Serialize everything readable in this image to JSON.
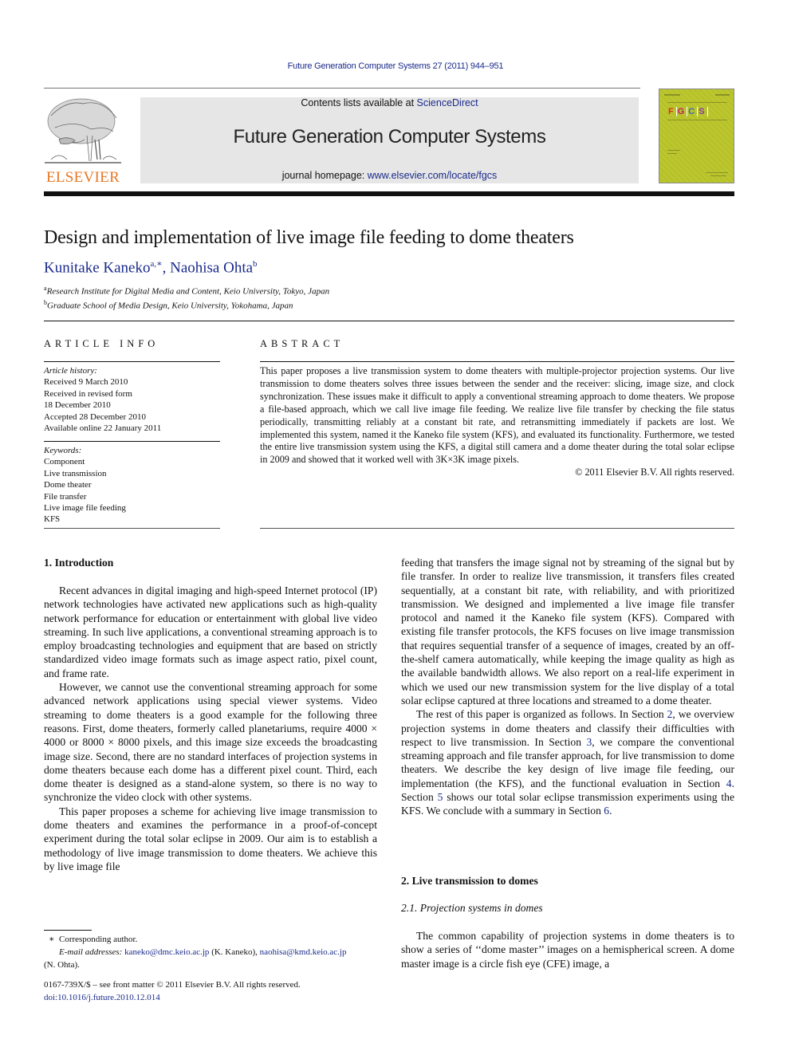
{
  "header": {
    "running_head": "Future Generation Computer Systems 27 (2011) 944–951",
    "contents_prefix": "Contents lists available at ",
    "contents_link": "ScienceDirect",
    "journal_title": "Future Generation Computer Systems",
    "homepage_prefix": "journal homepage: ",
    "homepage_link": "www.elsevier.com/locate/fgcs",
    "publisher_logo_text": "ELSEVIER",
    "cover_letters": [
      "F",
      "G",
      "C",
      "S"
    ]
  },
  "article": {
    "title": "Design and implementation of live image file feeding to dome theaters",
    "authors": [
      {
        "name": "Kunitake Kaneko",
        "marks": "a,∗"
      },
      {
        "name": "Naohisa Ohta",
        "marks": "b"
      }
    ],
    "affiliations": [
      {
        "mark": "a",
        "text": "Research Institute for Digital Media and Content, Keio University, Tokyo, Japan"
      },
      {
        "mark": "b",
        "text": "Graduate School of Media Design, Keio University, Yokohama, Japan"
      }
    ]
  },
  "article_info": {
    "heading": "ARTICLE INFO",
    "history_heading": "Article history:",
    "history": [
      "Received 9 March 2010",
      "Received in revised form",
      "18 December 2010",
      "Accepted 28 December 2010",
      "Available online 22 January 2011"
    ],
    "keywords_heading": "Keywords:",
    "keywords": [
      "Component",
      "Live transmission",
      "Dome theater",
      "File transfer",
      "Live image file feeding",
      "KFS"
    ]
  },
  "abstract": {
    "heading": "ABSTRACT",
    "text": "This paper proposes a live transmission system to dome theaters with multiple-projector projection systems. Our live transmission to dome theaters solves three issues between the sender and the receiver: slicing, image size, and clock synchronization. These issues make it difficult to apply a conventional streaming approach to dome theaters. We propose a file-based approach, which we call live image file feeding. We realize live file transfer by checking the file status periodically, transmitting reliably at a constant bit rate, and retransmitting immediately if packets are lost. We implemented this system, named it the Kaneko file system (KFS), and evaluated its functionality. Furthermore, we tested the entire live transmission system using the KFS, a digital still camera and a dome theater during the total solar eclipse in 2009 and showed that it worked well with 3K×3K image pixels.",
    "copyright": "© 2011 Elsevier B.V. All rights reserved."
  },
  "body": {
    "section1_heading": "1.  Introduction",
    "section1_paragraphs": [
      "Recent advances in digital imaging and high-speed Internet protocol (IP) network technologies have activated new applications such as high-quality network performance for education or entertainment with global live video streaming. In such live applications, a conventional streaming approach is to employ broadcasting technologies and equipment that are based on strictly standardized video image formats such as image aspect ratio, pixel count, and frame rate.",
      "However, we cannot use the conventional streaming approach for some advanced network applications using special viewer systems. Video streaming to dome theaters is a good example for the following three reasons. First, dome theaters, formerly called planetariums, require 4000 × 4000 or 8000 × 8000 pixels, and this image size exceeds the broadcasting image size. Second, there are no standard interfaces of projection systems in dome theaters because each dome has a different pixel count. Third, each dome theater is designed as a stand-alone system, so there is no way to synchronize the video clock with other systems.",
      "This paper proposes a scheme for achieving live image transmission to dome theaters and examines the performance in a proof-of-concept experiment during the total solar eclipse in 2009. Our aim is to establish a methodology of live image transmission to dome theaters. We achieve this by live image file"
    ],
    "right_continuation": "feeding that transfers the image signal not by streaming of the signal but by file transfer. In order to realize live transmission, it transfers files created sequentially, at a constant bit rate, with reliability, and with prioritized transmission. We designed and implemented a live image file transfer protocol and named it the Kaneko file system (KFS). Compared with existing file transfer protocols, the KFS focuses on live image transmission that requires sequential transfer of a sequence of images, created by an off-the-shelf camera automatically, while keeping the image quality as high as the available bandwidth allows. We also report on a real-life experiment in which we used our new transmission system for the live display of a total solar eclipse captured at three locations and streamed to a dome theater.",
    "organization": {
      "t1": "The rest of this paper is organized as follows. In Section ",
      "s2": "2",
      "t2": ", we overview projection systems in dome theaters and classify their difficulties with respect to live transmission. In Section ",
      "s3": "3",
      "t3": ", we compare the conventional streaming approach and file transfer approach, for live transmission to dome theaters. We describe the key design of live image file feeding, our implementation (the KFS), and the functional evaluation in Section ",
      "s4": "4",
      "t4": ". Section ",
      "s5": "5",
      "t5": " shows our total solar eclipse transmission experiments using the KFS. We conclude with a summary in Section ",
      "s6": "6",
      "t6": "."
    },
    "section2_heading": "2.  Live transmission to domes",
    "subsection21_heading": "2.1.  Projection systems in domes",
    "section21_paragraph": "The common capability of projection systems in dome theaters is to show a series of ‘‘dome master’’ images on a hemispherical screen. A dome master image is a circle fish eye (CFE) image, a"
  },
  "footnotes": {
    "star": "∗",
    "corresponding": "Corresponding author.",
    "email_label": "E-mail addresses:",
    "email1": "kaneko@dmc.keio.ac.jp",
    "email1_owner": " (K. Kaneko), ",
    "email2": "naohisa@kmd.keio.ac.jp",
    "email2_owner": "(N. Ohta).",
    "front_matter": "0167-739X/$ – see front matter © 2011 Elsevier B.V. All rights reserved.",
    "doi": "doi:10.1016/j.future.2010.12.014"
  }
}
